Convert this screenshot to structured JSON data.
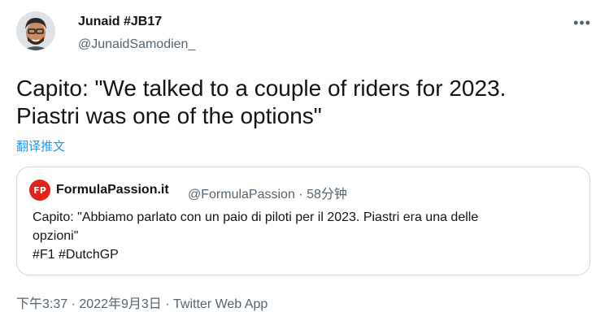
{
  "author": {
    "name": "Junaid #JB17",
    "handle": "@JunaidSamodien_"
  },
  "more_icon": "more-icon",
  "tweet": {
    "text": "Capito: \"We talked to a couple of riders for 2023.\nPiastri was one of the options\"",
    "translate_label": "翻译推文"
  },
  "quote": {
    "logo_text": "FP",
    "name": "FormulaPassion.it",
    "handle": "@FormulaPassion",
    "separator": "·",
    "time": "58分钟",
    "text": "Capito: \"Abbiamo parlato con un paio di piloti per il 2023. Piastri era una delle\nopzioni\"\n#F1 #DutchGP"
  },
  "footer": {
    "time": "下午3:37",
    "sep1": "·",
    "date": "2022年9月3日",
    "sep2": "·",
    "source": "Twitter Web App"
  },
  "colors": {
    "link": "#1d9bf0",
    "muted": "#536471",
    "border": "#cfd9de",
    "logo": "#e2231a"
  }
}
